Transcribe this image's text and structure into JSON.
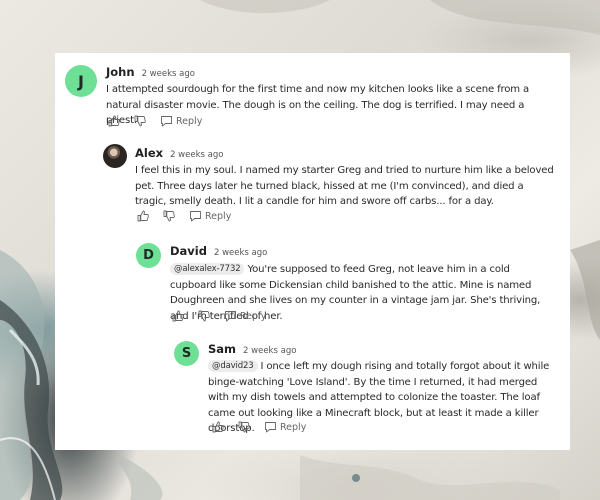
{
  "comments": [
    {
      "avatar_letter": "J",
      "author": "John",
      "time": "2 weeks ago",
      "mention": "",
      "text": "I attempted sourdough for the first time and now my kitchen looks like a scene from a natural disaster movie. The dough is on the ceiling. The dog is terrified. I may need a priest.",
      "reply_label": "Reply"
    },
    {
      "avatar_letter": "",
      "author": "Alex",
      "time": "2 weeks ago",
      "mention": "",
      "text": "I feel this in my soul. I named my starter Greg and tried to nurture him like a beloved pet. Three days later he turned black, hissed at me (I'm convinced), and died a tragic, smelly death. I lit a candle for him and swore off carbs... for a day.",
      "reply_label": "Reply"
    },
    {
      "avatar_letter": "D",
      "author": "David",
      "time": "2 weeks ago",
      "mention": "@alexalex-7732",
      "text": "You're supposed to feed Greg, not leave him in a cold cupboard like some Dickensian child banished to the attic. Mine is named Doughreen and she lives on my counter in a vintage jam jar. She's thriving, and I'm terrified of her.",
      "reply_label": "Reply"
    },
    {
      "avatar_letter": "S",
      "author": "Sam",
      "time": "2 weeks ago",
      "mention": "@david23",
      "text": "I once left my dough rising and totally forgot about it while binge-watching 'Love Island'. By the time I returned, it had merged with my dish towels and attempted to colonize the toaster. The loaf came out looking like a Minecraft block, but at least it made a killer doorstop.",
      "reply_label": "Reply"
    }
  ],
  "icons": {
    "upvote": "thumbs-up-icon",
    "downvote": "thumbs-down-icon",
    "reply": "speech-bubble-icon"
  },
  "colors": {
    "avatar": "#6ee095",
    "card": "#ffffff"
  }
}
